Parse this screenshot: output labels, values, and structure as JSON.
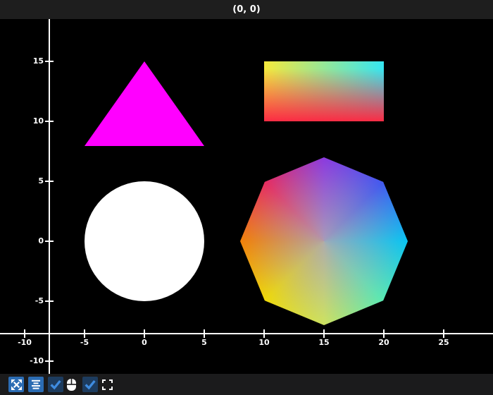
{
  "window": {
    "title_bar_text": "(0, 0)"
  },
  "plot": {
    "background": "#000000",
    "axis_color": "#ffffff",
    "x_axis": {
      "tick_labels": [
        "-10",
        "-5",
        "0",
        "5",
        "10",
        "15",
        "20",
        "25"
      ],
      "tick_values": [
        -10,
        -5,
        0,
        5,
        10,
        15,
        20,
        25
      ],
      "range": [
        -12.1,
        29.1
      ]
    },
    "y_axis": {
      "tick_labels": [
        "15",
        "10",
        "5",
        "0",
        "-5",
        "-10"
      ],
      "tick_values": [
        15,
        10,
        5,
        0,
        -5,
        -10
      ],
      "range": [
        -11,
        18.4
      ]
    },
    "shapes": {
      "triangle": {
        "vertices": [
          [
            -5,
            8
          ],
          [
            5,
            8
          ],
          [
            0,
            15
          ]
        ],
        "fill": "#ff00ff"
      },
      "gradient_rect": {
        "x_range": [
          10,
          20
        ],
        "y_range": [
          10,
          15
        ],
        "corner_top_left": "#f6e93c",
        "corner_top_right": "#35e6f2",
        "bottom_edge": "#fb2b44"
      },
      "circle": {
        "center": [
          0,
          0
        ],
        "radius": 5,
        "fill": "#ffffff"
      },
      "octagon": {
        "center": [
          15,
          0
        ],
        "radius": 7,
        "vertex_colors_clockwise_from_top": [
          "#8a35e0",
          "#3c55f2",
          "#00c6f5",
          "#55edb2",
          "#cfe55c",
          "#f2dc00",
          "#f57f00",
          "#e9265c"
        ],
        "center_blend": "#aca6b4"
      }
    }
  },
  "toolbar": {
    "button_color": "#2b6cb3",
    "checkbox_bg": "#1d3c5f",
    "checkmark_color": "#3f8ce0",
    "icon_color": "#ffffff",
    "items": [
      {
        "name": "expand-arrows-button",
        "type": "button"
      },
      {
        "name": "align-center-button",
        "type": "button"
      },
      {
        "name": "checkbox-1",
        "type": "checkbox",
        "checked": true
      },
      {
        "name": "mouse-icon",
        "type": "icon"
      },
      {
        "name": "checkbox-2",
        "type": "checkbox",
        "checked": true
      },
      {
        "name": "frame-corners-icon",
        "type": "icon"
      }
    ]
  },
  "colors": {
    "title_bar_bg": "#1e1e1e",
    "toolbar_bg": "#1b1b1c",
    "plot_bg": "#000000"
  }
}
